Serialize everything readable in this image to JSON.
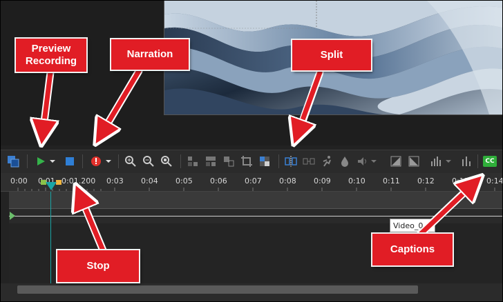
{
  "callouts": {
    "preview": "Preview\nRecording",
    "narration": "Narration",
    "split": "Split",
    "stop": "Stop",
    "captions": "Captions"
  },
  "toolbar": {
    "cc_label": "CC"
  },
  "ruler": {
    "ticks": [
      "0:00",
      "0:01",
      "0:01.200",
      "0:03",
      "0:04",
      "0:05",
      "0:06",
      "0:07",
      "0:08",
      "0:09",
      "0:10",
      "0:11",
      "0:12",
      "0:13",
      "0:14"
    ]
  },
  "timeline": {
    "clip_label": "Video_0"
  },
  "colors": {
    "callout": "#e11d25",
    "play": "#35b34a",
    "stop": "#2f7fd6",
    "record": "#e0302b",
    "cc": "#2fae3a",
    "playhead": "#1aa5a5"
  }
}
